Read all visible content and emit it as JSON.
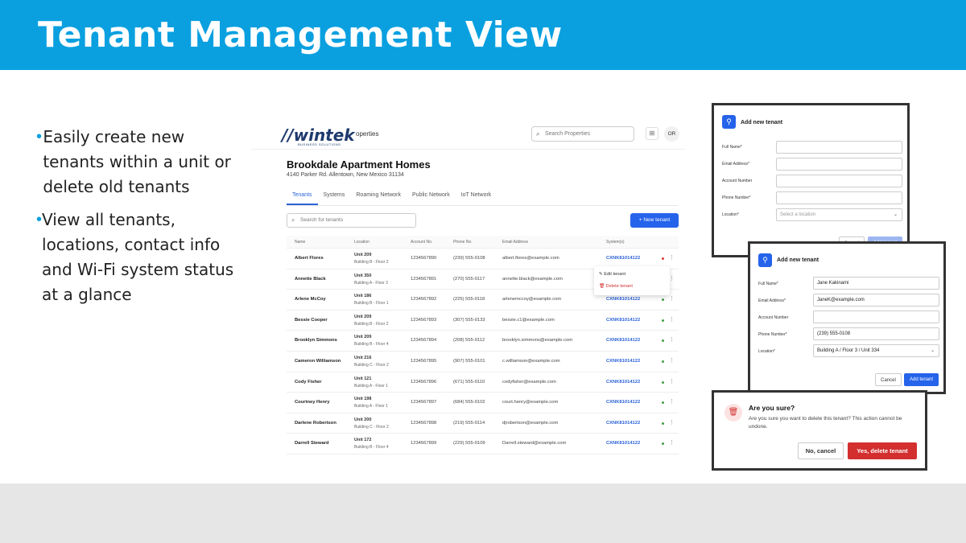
{
  "slide": {
    "title": "Tenant Management View",
    "bullets": [
      "Easily create new tenants within a unit or delete old tenants",
      "View all tenants, locations, contact info and Wi-Fi system status at a glance"
    ]
  },
  "app": {
    "logo": "wintek",
    "logo_sub": "BUSINESS SOLUTIONS",
    "nav_fragment": "operties",
    "search_properties_placeholder": "Search Properties",
    "avatar_initials": "OR",
    "property_name": "Brookdale Apartment Homes",
    "property_address": "4140 Parker Rd. Allentown, New Mexico 31134",
    "tabs": [
      "Tenants",
      "Systems",
      "Roaming Network",
      "Public Network",
      "IoT Network"
    ],
    "search_tenants_placeholder": "Search for tenants",
    "new_tenant_label": "New tenant",
    "columns": [
      "Name",
      "Location",
      "Account No.",
      "Phone No.",
      "Email Address",
      "System(s)"
    ],
    "rows": [
      {
        "name": "Albert Flores",
        "unit": "Unit 209",
        "building": "Building B - Floor 2",
        "account": "1234567890",
        "phone": "(239) 555-0108",
        "email": "albert.flores@example.com",
        "system": "CXNK81014122",
        "status_color": "#e53935"
      },
      {
        "name": "Annette Black",
        "unit": "Unit 350",
        "building": "Building A - Floor 3",
        "account": "1234567891",
        "phone": "(270) 555-0117",
        "email": "annette.black@example.com",
        "system": "",
        "status_color": ""
      },
      {
        "name": "Arlene McCoy",
        "unit": "Unit 186",
        "building": "Building B - Floor 1",
        "account": "1234567892",
        "phone": "(225) 555-0118",
        "email": "arlenemccoy@example.com",
        "system": "CXNK81014122",
        "status_color": "#43a047"
      },
      {
        "name": "Bessie Cooper",
        "unit": "Unit 209",
        "building": "Building B - Floor 2",
        "account": "1234567893",
        "phone": "(307) 555-0133",
        "email": "bessie.c1@example.com",
        "system": "CXNK81014122",
        "status_color": "#43a047"
      },
      {
        "name": "Brooklyn Simmons",
        "unit": "Unit 209",
        "building": "Building B - Floor 4",
        "account": "1234567894",
        "phone": "(208) 555-0112",
        "email": "brooklyn.simmons@example.com",
        "system": "CXNK81014122",
        "status_color": "#43a047"
      },
      {
        "name": "Cameron Williamson",
        "unit": "Unit 216",
        "building": "Building C - Floor 2",
        "account": "1234567895",
        "phone": "(907) 555-0101",
        "email": "c.williamson@example.com",
        "system": "CXNK81014122",
        "status_color": "#43a047"
      },
      {
        "name": "Cody Fisher",
        "unit": "Unit 121",
        "building": "Building A - Floor 1",
        "account": "1234567896",
        "phone": "(671) 555-0110",
        "email": "codyfisher@example.com",
        "system": "CXNK81014122",
        "status_color": "#43a047"
      },
      {
        "name": "Courtney Henry",
        "unit": "Unit 198",
        "building": "Building A - Floor 1",
        "account": "1234567897",
        "phone": "(684) 555-0102",
        "email": "court.henry@example.com",
        "system": "CXNK81014122",
        "status_color": "#43a047"
      },
      {
        "name": "Darlene Robertson",
        "unit": "Unit 200",
        "building": "Building C - Floor 2",
        "account": "1234567898",
        "phone": "(219) 555-0114",
        "email": "djrobertson@example.com",
        "system": "CXNK81014122",
        "status_color": "#43a047"
      },
      {
        "name": "Darrell Steward",
        "unit": "Unit 172",
        "building": "Building B - Floor 4",
        "account": "1234567899",
        "phone": "(229) 555-0109",
        "email": "Darrell.steward@example.com",
        "system": "CXNK81014122",
        "status_color": "#43a047"
      }
    ],
    "row_menu": {
      "edit": "Edit tenant",
      "delete": "Delete tenant"
    }
  },
  "add_panel_empty": {
    "title": "Add new tenant",
    "labels": [
      "Full Name*",
      "Email Address*",
      "Account Number",
      "Phone Number*",
      "Location*"
    ],
    "location_placeholder": "Select a location",
    "cancel": "Cancel",
    "add": "Add tenant"
  },
  "add_panel_filled": {
    "title": "Add new tenant",
    "labels": [
      "Full Name*",
      "Email Address*",
      "Account Number",
      "Phone Number*",
      "Location*"
    ],
    "values": [
      "Jane Kakinami",
      "JaneK@example.com",
      "",
      "(239) 555-0108",
      "Building A  /  Floor 3  /  Unit 334"
    ],
    "cancel": "Cancel",
    "add": "Add tenant"
  },
  "confirm_dialog": {
    "title": "Are you sure?",
    "message": "Are you sure you want to delete this tenant? This action cannot be undone.",
    "no": "No, cancel",
    "yes": "Yes, delete tenant"
  },
  "colors": {
    "header": "#0aa0e0",
    "primary": "#2563eb",
    "danger": "#d32f2f"
  }
}
